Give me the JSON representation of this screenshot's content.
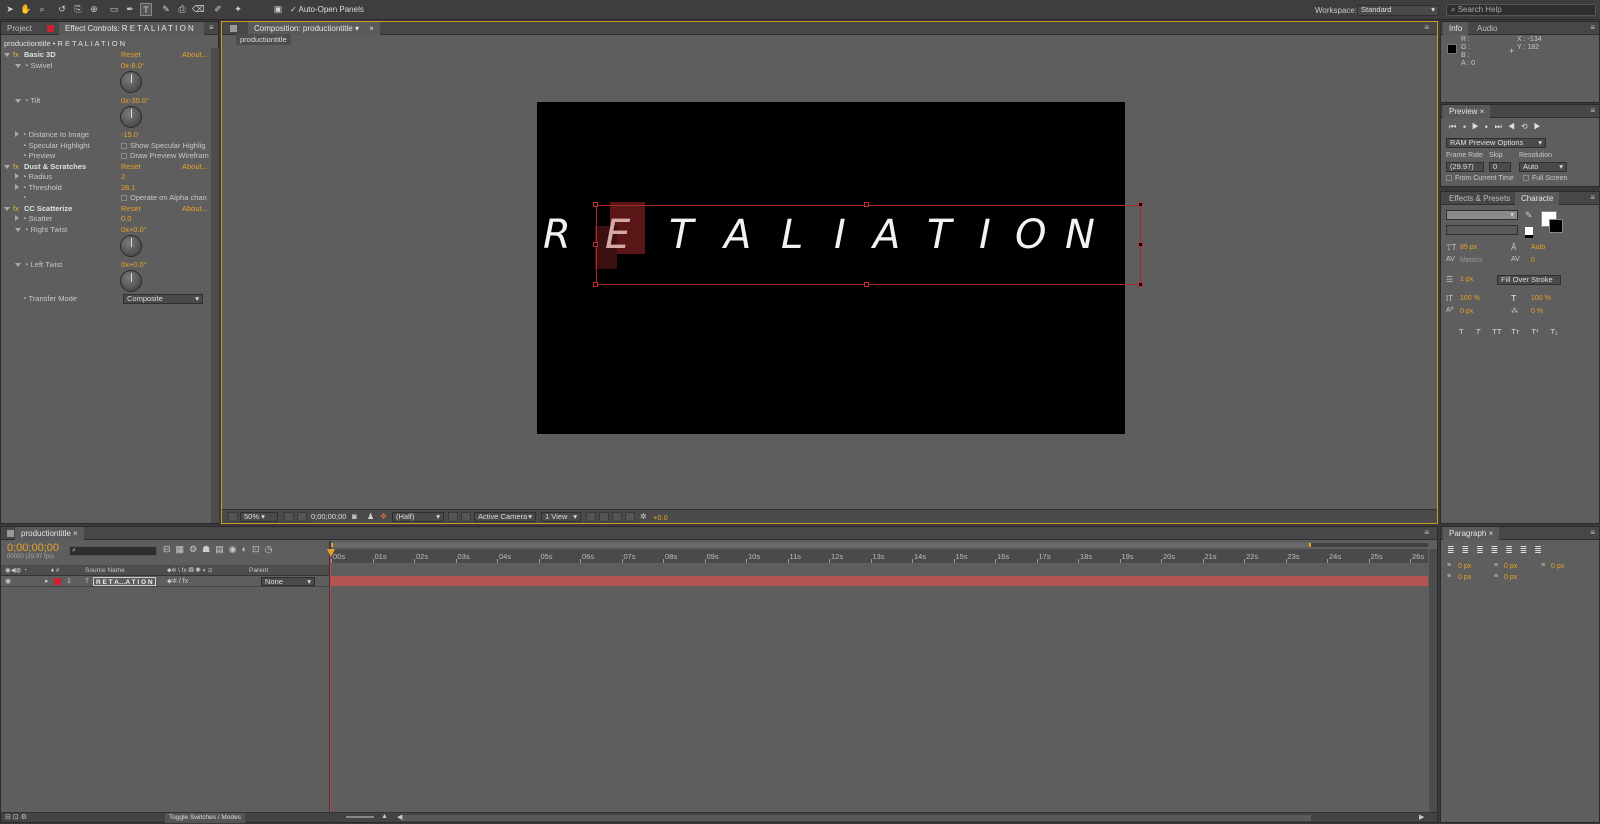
{
  "toolbar": {
    "auto_open_label": "Auto-Open Panels",
    "workspace_label": "Workspace:",
    "workspace_value": "Standard",
    "search_placeholder": "Search Help"
  },
  "left_panel": {
    "tabs": [
      "Project",
      "Effect Controls: R E T A L I A T I O N"
    ],
    "header": "productiontitle • R E T A L I A T I O N",
    "reset": "Reset",
    "about": "About...",
    "effects": [
      {
        "name": "Basic 3D",
        "props": [
          {
            "label": "Swivel",
            "value": "0x-8.0°",
            "dial": true
          },
          {
            "label": "Tilt",
            "value": "0x-35.0°",
            "dial": true
          },
          {
            "label": "Distance to Image",
            "value": "-15.0"
          },
          {
            "label": "Specular Highlight",
            "check": "Show Specular Highlig"
          },
          {
            "label": "Preview",
            "check": "Draw Preview Wirefram"
          }
        ]
      },
      {
        "name": "Dust & Scratches",
        "props": [
          {
            "label": "Radius",
            "value": "2"
          },
          {
            "label": "Threshold",
            "value": "28.1"
          },
          {
            "label": "",
            "check": "Operate on Alpha chan"
          }
        ]
      },
      {
        "name": "CC Scatterize",
        "props": [
          {
            "label": "Scatter",
            "value": "0.0"
          },
          {
            "label": "Right Twist",
            "value": "0x+0.0°",
            "dial": true
          },
          {
            "label": "Left Twist",
            "value": "0x+0.0°",
            "dial": true
          },
          {
            "label": "Transfer Mode",
            "select": "Composite"
          }
        ]
      }
    ]
  },
  "composition": {
    "tab": "Composition: productiontitle",
    "breadcrumb": "productiontitle",
    "title_text": "R E T A L I A T I O N",
    "letters": [
      "R",
      "E",
      "T",
      "A",
      "L",
      "I",
      "A",
      "T",
      "I",
      "O",
      "N"
    ],
    "zoom": "50%",
    "timecode": "0;00;00;00",
    "resolution": "(Half)",
    "camera": "Active Camera",
    "views": "1 View",
    "exposure": "+0.0"
  },
  "info_panel": {
    "tabs": [
      "Info",
      "Audio"
    ],
    "r": "R :",
    "g": "G :",
    "b": "B :",
    "a": "A : 0",
    "x": "X : -134",
    "y": "Y : 182"
  },
  "preview_panel": {
    "tab": "Preview",
    "ram_options": "RAM Preview Options",
    "frame_rate_label": "Frame Rate",
    "skip_label": "Skip",
    "resolution_label": "Resolution",
    "frame_rate": "(29.97)",
    "skip": "0",
    "resolution": "Auto",
    "from_current": "From Current Time",
    "full_screen": "Full Screen"
  },
  "character_panel": {
    "tabs": [
      "Effects & Presets",
      "Characte"
    ],
    "font_size": "85 px",
    "leading": "Auto",
    "kerning": "Metrics",
    "tracking": "0",
    "stroke": "1 px",
    "stroke_mode": "Fill Over Stroke",
    "v_scale": "100 %",
    "h_scale": "100 %",
    "baseline": "0 px",
    "tsume": "0 %",
    "style_buttons": [
      "T",
      "T",
      "TT",
      "Tт",
      "T¹",
      "T₁"
    ]
  },
  "paragraph_panel": {
    "tab": "Paragraph",
    "indent_values": [
      "0 px",
      "0 px",
      "0 px",
      "0 px",
      "0 px"
    ]
  },
  "timeline": {
    "tab": "productiontitle",
    "timecode": "0;00;00;00",
    "fps": "00000 (29.97 fps)",
    "col_source": "Source Name",
    "col_parent": "Parent",
    "layer_num": "1",
    "layer_name": "R E T A…A T I O N",
    "parent_value": "None",
    "ruler": [
      "00s",
      "01s",
      "02s",
      "03s",
      "04s",
      "05s",
      "06s",
      "07s",
      "08s",
      "09s",
      "10s",
      "11s",
      "12s",
      "13s",
      "14s",
      "15s",
      "16s",
      "17s",
      "18s",
      "19s",
      "20s",
      "21s",
      "22s",
      "23s",
      "24s",
      "25s",
      "26s",
      "2"
    ],
    "toggle_label": "Toggle Switches / Modes"
  }
}
